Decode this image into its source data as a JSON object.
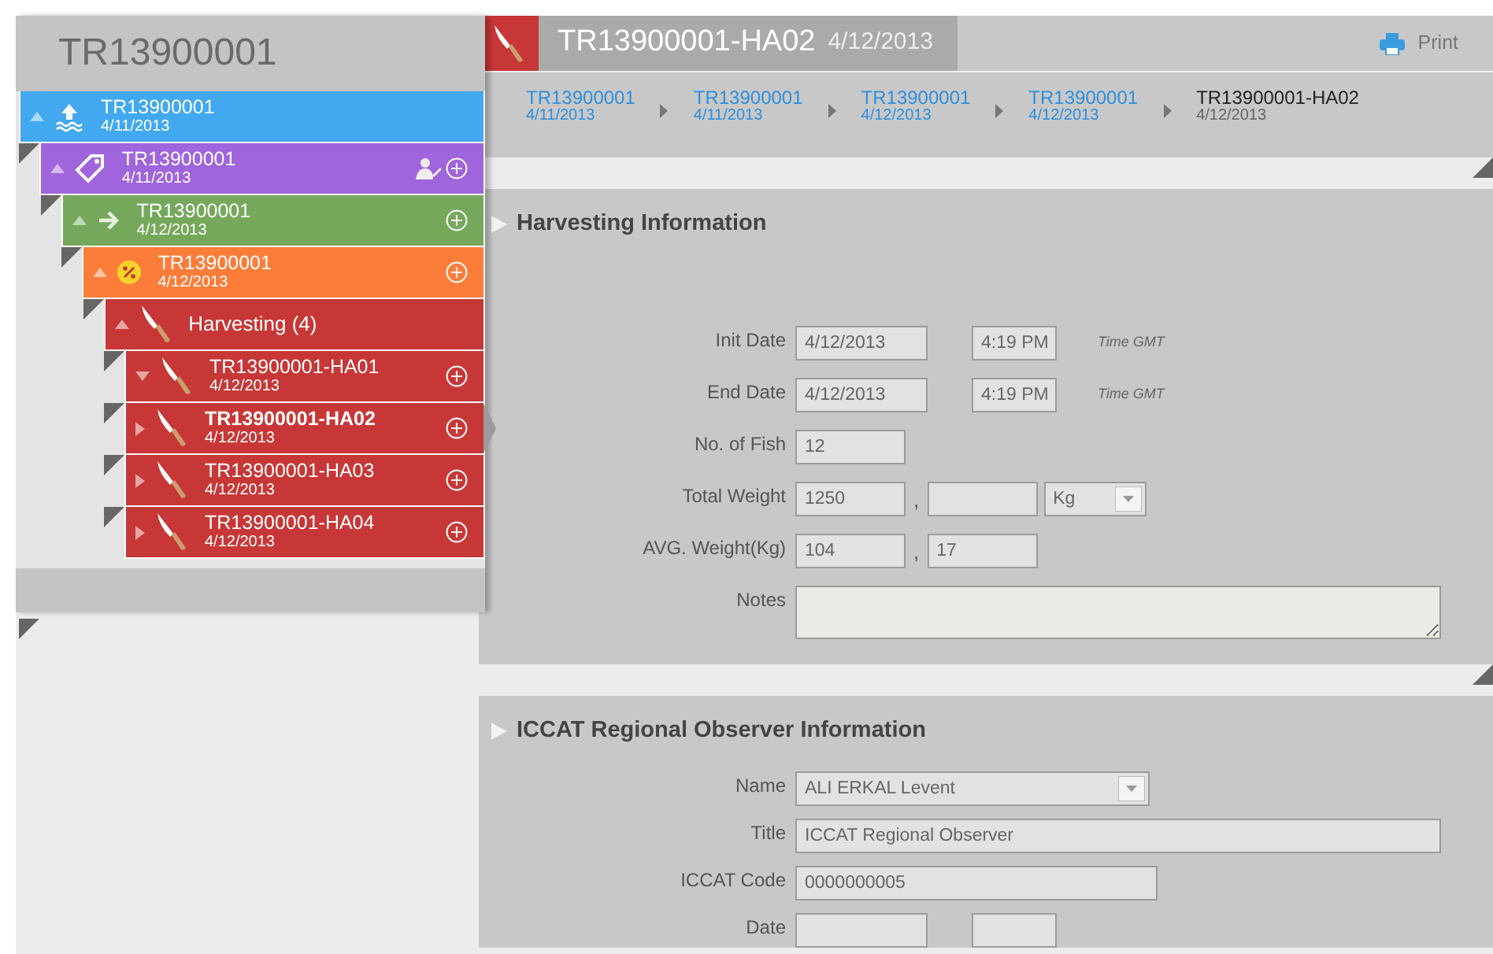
{
  "tree_title": "TR13900001",
  "tree": [
    {
      "title": "TR13900001",
      "date": "4/11/2013",
      "kind": "departure",
      "color": "#42a8f0",
      "expanded": true,
      "assign": false,
      "add": false,
      "selected": false,
      "children": [
        {
          "title": "TR13900001",
          "date": "4/11/2013",
          "kind": "tagging",
          "color": "#a064dc",
          "expanded": true,
          "assign": true,
          "add": true,
          "selected": false,
          "children": [
            {
              "title": "TR13900001",
              "date": "4/12/2013",
              "kind": "transfer",
              "color": "#76a85c",
              "expanded": true,
              "assign": false,
              "add": true,
              "selected": false,
              "children": [
                {
                  "title": "TR13900001",
                  "date": "4/12/2013",
                  "kind": "caging",
                  "color": "#fc7d3a",
                  "expanded": true,
                  "assign": false,
                  "add": true,
                  "selected": false,
                  "children": [
                    {
                      "title": "Harvesting (4)",
                      "kind": "harvest",
                      "color": "#c83737",
                      "expanded": true,
                      "assign": false,
                      "add": false,
                      "selected": false,
                      "children": [
                        {
                          "title": "TR13900001-HA01",
                          "date": "4/12/2013",
                          "kind": "harvest",
                          "color": "#c83737",
                          "expanded": true,
                          "assign": false,
                          "add": true,
                          "selected": false
                        },
                        {
                          "title": "TR13900001-HA02",
                          "date": "4/12/2013",
                          "kind": "harvest",
                          "color": "#c83737",
                          "expanded": false,
                          "assign": false,
                          "add": true,
                          "selected": true
                        },
                        {
                          "title": "TR13900001-HA03",
                          "date": "4/12/2013",
                          "kind": "harvest",
                          "color": "#c83737",
                          "expanded": false,
                          "assign": false,
                          "add": true,
                          "selected": false
                        },
                        {
                          "title": "TR13900001-HA04",
                          "date": "4/12/2013",
                          "kind": "harvest",
                          "color": "#c83737",
                          "expanded": false,
                          "assign": false,
                          "add": true,
                          "selected": false
                        }
                      ]
                    }
                  ]
                }
              ]
            }
          ]
        }
      ]
    }
  ],
  "header": {
    "title": "TR13900001-HA02",
    "date": "4/12/2013",
    "print": "Print"
  },
  "breadcrumb": [
    {
      "title": "TR13900001",
      "date": "4/11/2013",
      "selected": false
    },
    {
      "title": "TR13900001",
      "date": "4/11/2013",
      "selected": false
    },
    {
      "title": "TR13900001",
      "date": "4/12/2013",
      "selected": false
    },
    {
      "title": "TR13900001",
      "date": "4/12/2013",
      "selected": false
    },
    {
      "title": "TR13900001-HA02",
      "date": "4/12/2013",
      "selected": true
    }
  ],
  "sections": [
    {
      "title": "Harvesting Information",
      "rows": [
        {
          "label": "Init Date",
          "parts": [
            {
              "kind": "date",
              "value": "4/12/2013"
            },
            {
              "kind": "time",
              "value": "4:19 PM"
            },
            {
              "kind": "note",
              "text": "Time GMT"
            }
          ]
        },
        {
          "label": "End Date",
          "parts": [
            {
              "kind": "date",
              "value": "4/12/2013"
            },
            {
              "kind": "time",
              "value": "4:19 PM"
            },
            {
              "kind": "note",
              "text": "Time GMT"
            }
          ]
        },
        {
          "label": "No. of Fish",
          "parts": [
            {
              "kind": "short",
              "value": "12"
            }
          ]
        },
        {
          "label": "Total Weight",
          "parts": [
            {
              "kind": "short",
              "value": "1250"
            },
            {
              "kind": "sep",
              "text": ","
            },
            {
              "kind": "short"
            },
            {
              "kind": "select",
              "value": "Kg"
            }
          ]
        },
        {
          "label": "AVG. Weight(Kg)",
          "parts": [
            {
              "kind": "short",
              "value": "104"
            },
            {
              "kind": "sep",
              "text": ","
            },
            {
              "kind": "short",
              "value": "17"
            }
          ]
        },
        {
          "label": "Notes",
          "parts": [
            {
              "kind": "area"
            }
          ]
        }
      ]
    },
    {
      "title": "ICCAT Regional Observer Information",
      "rows": [
        {
          "label": "Name",
          "parts": [
            {
              "kind": "select-wide",
              "value": "ALI ERKAL Levent"
            }
          ]
        },
        {
          "label": "Title",
          "parts": [
            {
              "kind": "wide",
              "value": "ICCAT Regional Observer"
            }
          ]
        },
        {
          "label": "ICCAT Code",
          "parts": [
            {
              "kind": "medium",
              "value": "0000000005"
            }
          ]
        },
        {
          "label": "Date",
          "parts": [
            {
              "kind": "date"
            },
            {
              "kind": "time"
            }
          ]
        }
      ]
    }
  ]
}
